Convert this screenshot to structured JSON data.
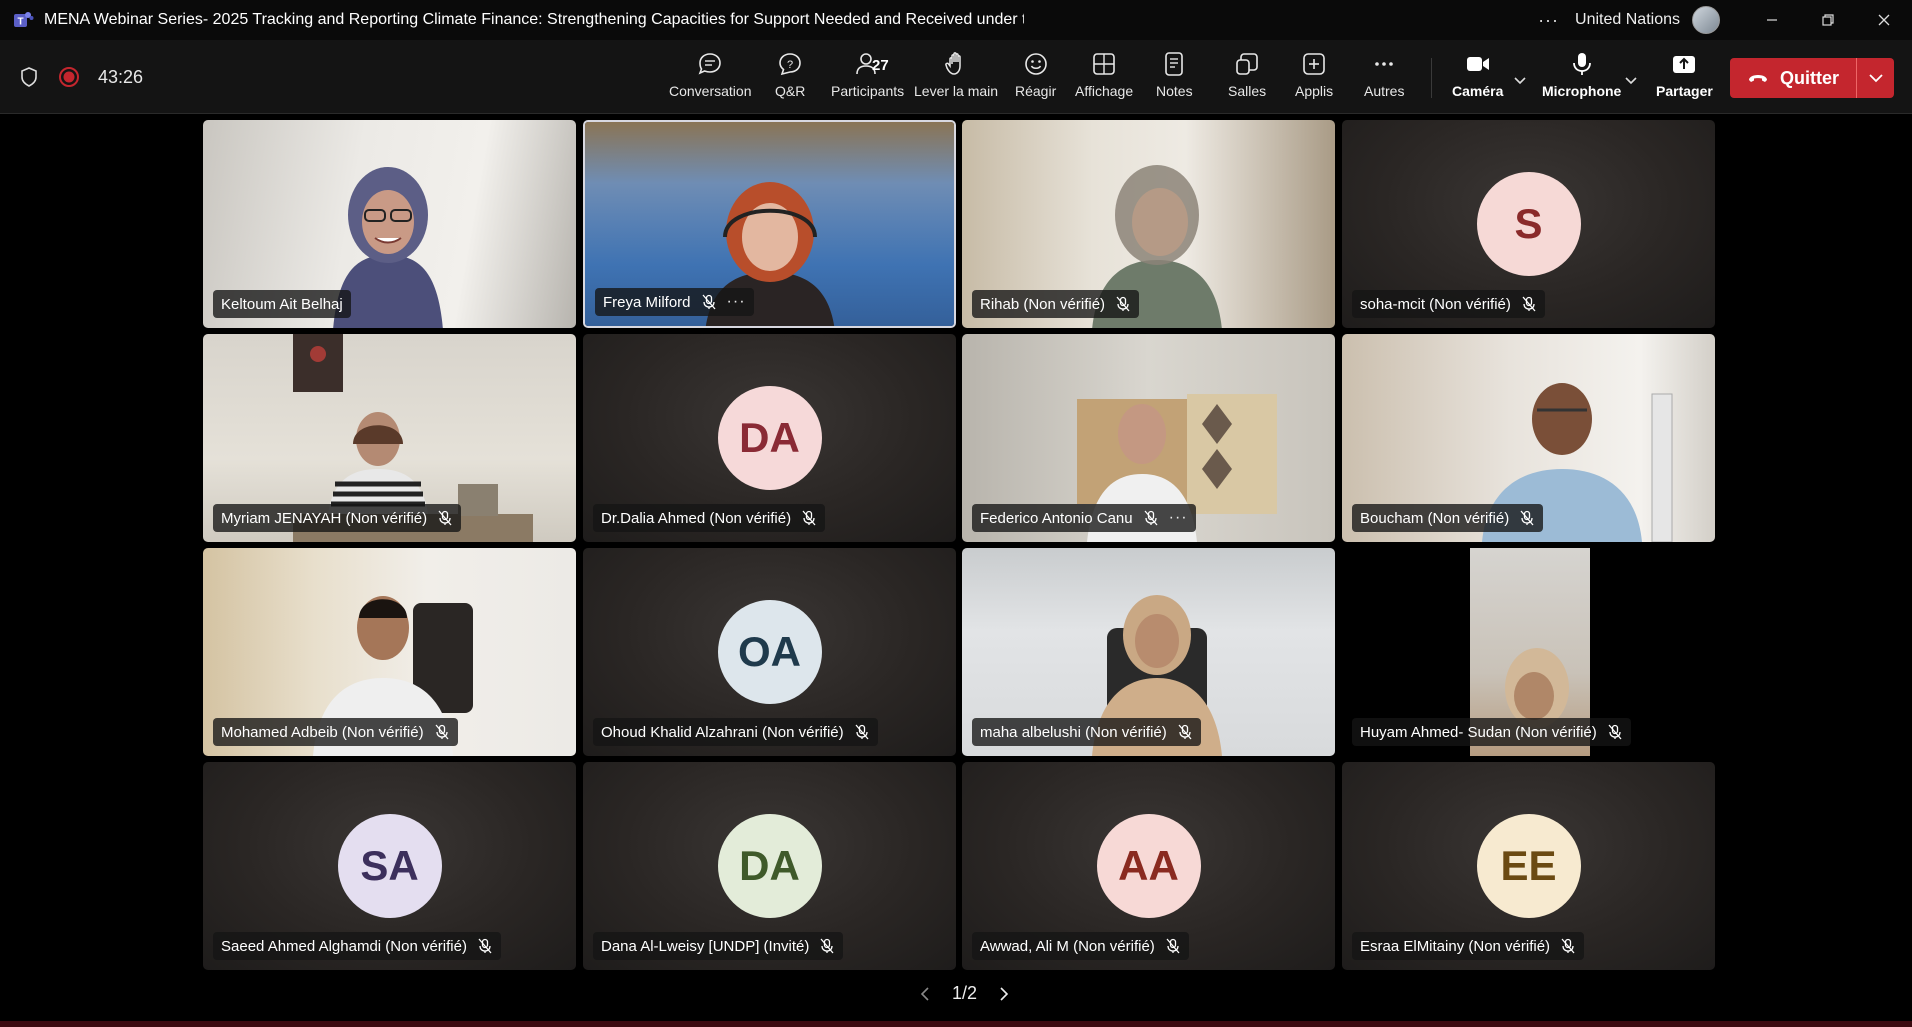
{
  "window": {
    "title": "MENA Webinar Series- 2025 Tracking and Reporting Climate Finance: Strengthening Capacities for Support Needed and Received under t...",
    "org": "United Nations"
  },
  "toolbar": {
    "timer": "43:26",
    "items": {
      "conversation": "Conversation",
      "qa": "Q&R",
      "participants": "Participants",
      "participants_count": "27",
      "raise_hand": "Lever la main",
      "react": "Réagir",
      "view": "Affichage",
      "notes": "Notes",
      "rooms": "Salles",
      "apps": "Applis",
      "more": "Autres",
      "camera": "Caméra",
      "mic": "Microphone",
      "share": "Partager"
    },
    "quit_label": "Quitter"
  },
  "participants": [
    {
      "name": "Keltoum Ait Belhaj",
      "muted": false,
      "video": true
    },
    {
      "name": "Freya Milford",
      "muted": true,
      "video": true,
      "speaking": true,
      "more": "···"
    },
    {
      "name": "Rihab (Non vérifié)",
      "muted": true,
      "video": true
    },
    {
      "name": "soha-mcit (Non vérifié)",
      "muted": true,
      "video": false,
      "initials": "S",
      "avatar_bg": "#f6d9d6",
      "avatar_fg": "#8a2a2a"
    },
    {
      "name": "Myriam JENAYAH (Non vérifié)",
      "muted": true,
      "video": true
    },
    {
      "name": "Dr.Dalia Ahmed (Non vérifié)",
      "muted": true,
      "video": false,
      "initials": "DA",
      "avatar_bg": "#f6d9d9",
      "avatar_fg": "#8a2a35"
    },
    {
      "name": "Federico Antonio Canu",
      "muted": true,
      "video": true,
      "more": "···"
    },
    {
      "name": "Boucham (Non vérifié)",
      "muted": true,
      "video": true
    },
    {
      "name": "Mohamed Adbeib (Non vérifié)",
      "muted": true,
      "video": true
    },
    {
      "name": "Ohoud Khalid Alzahrani (Non vérifié)",
      "muted": true,
      "video": false,
      "initials": "OA",
      "avatar_bg": "#dde6ec",
      "avatar_fg": "#1f3a4c"
    },
    {
      "name": "maha albelushi (Non vérifié)",
      "muted": true,
      "video": true
    },
    {
      "name": "Huyam Ahmed- Sudan (Non vérifié)",
      "muted": true,
      "video": true
    },
    {
      "name": "Saeed Ahmed Alghamdi (Non vérifié)",
      "muted": true,
      "video": false,
      "initials": "SA",
      "avatar_bg": "#e4def0",
      "avatar_fg": "#3c2f5c"
    },
    {
      "name": "Dana Al-Lweisy [UNDP] (Invité)",
      "muted": true,
      "video": false,
      "initials": "DA",
      "avatar_bg": "#e3ecd9",
      "avatar_fg": "#3f5a2a"
    },
    {
      "name": "Awwad, Ali M (Non vérifié)",
      "muted": true,
      "video": false,
      "initials": "AA",
      "avatar_bg": "#f7d9d6",
      "avatar_fg": "#8a2a20"
    },
    {
      "name": "Esraa ElMitainy (Non vérifié)",
      "muted": true,
      "video": false,
      "initials": "EE",
      "avatar_bg": "#f7ead0",
      "avatar_fg": "#6b4a12"
    }
  ],
  "pager": {
    "label": "1/2"
  },
  "colors": {
    "quit": "#c4262e",
    "background": "#000000",
    "toolbar": "#141414"
  }
}
